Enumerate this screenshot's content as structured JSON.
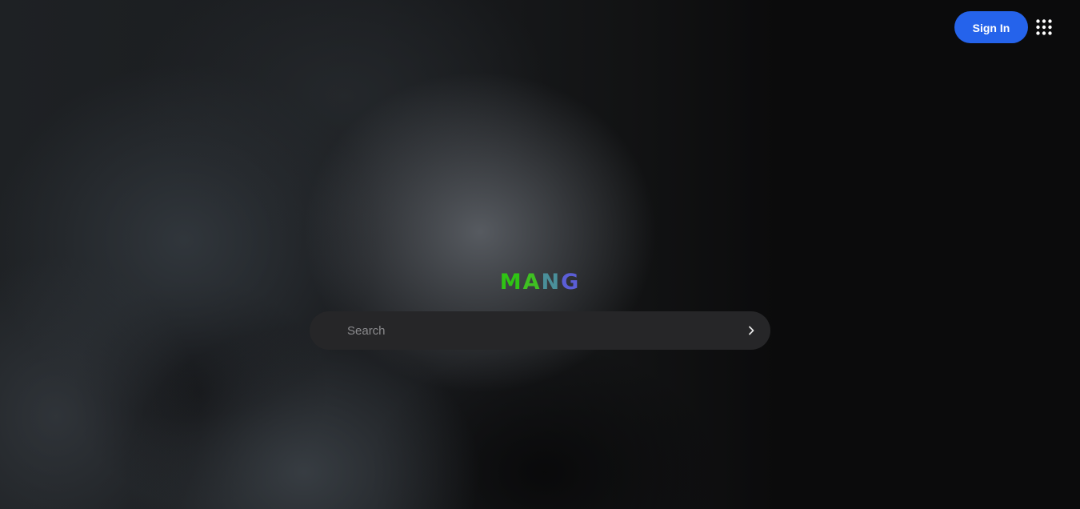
{
  "header": {
    "sign_in_label": "Sign In",
    "apps_icon": "grid-dots-icon"
  },
  "logo": {
    "letters": [
      "M",
      "A",
      "N",
      "G"
    ],
    "colors": [
      "#2fc414",
      "#3fbf22",
      "#4a8f9a",
      "#5b5ed6"
    ]
  },
  "search": {
    "placeholder": "Search",
    "value": "",
    "submit_icon": "chevron-right-icon"
  },
  "colors": {
    "accent": "#2563eb",
    "search_bg": "#262628"
  }
}
